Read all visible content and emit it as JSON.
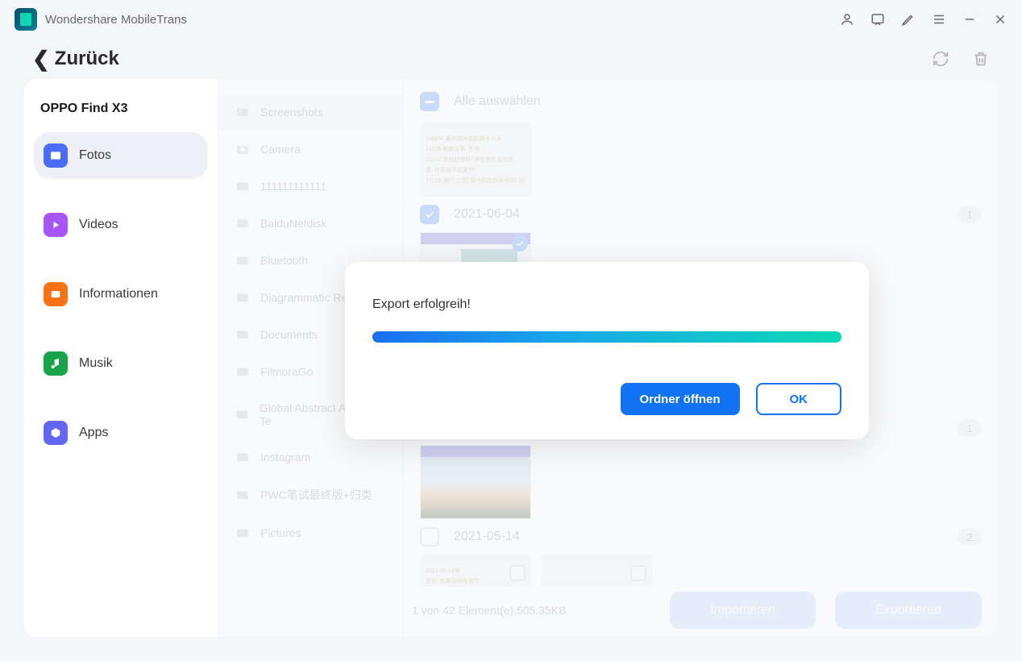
{
  "app": {
    "title": "Wondershare MobileTrans"
  },
  "back": {
    "label": "Zurück"
  },
  "device": {
    "name": "OPPO Find X3"
  },
  "nav": {
    "fotos": "Fotos",
    "videos": "Videos",
    "info": "Informationen",
    "musik": "Musik",
    "apps": "Apps"
  },
  "folders": [
    "Screenshots",
    "Camera",
    "111111111111",
    "BaiduNetdisk",
    "Bluetooth",
    "Diagrammatic Re",
    "Documents",
    "FilmoraGo",
    "Global Abstract Aptitude Te",
    "Instagram",
    "PWC笔试最终版+归类",
    "Pictures"
  ],
  "selectAll": "Alle auswählen",
  "dates": {
    "d1": "2021-06-04",
    "d2": "2021-05-14",
    "c1": "1",
    "c2": "1",
    "c3": "2"
  },
  "status": "1 von 42 Element(e),505.35KB",
  "buttons": {
    "import": "Importieren",
    "export": "Exportieren"
  },
  "modal": {
    "title": "Export erfolgreih!",
    "open": "Ordner öffnen",
    "ok": "OK"
  }
}
